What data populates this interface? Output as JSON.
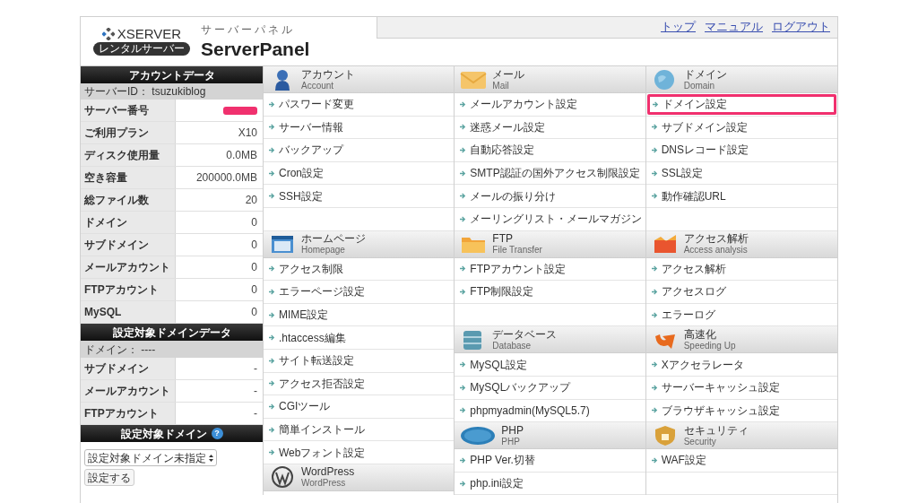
{
  "header": {
    "brand": "XSERVER",
    "brand_badge": "レンタルサーバー",
    "product_kana": "サーバーパネル",
    "product": "ServerPanel",
    "links": [
      "トップ",
      "マニュアル",
      "ログアウト"
    ]
  },
  "sidebar": {
    "account_title": "アカウントデータ",
    "server_id": "サーバーID： tsuzukiblog",
    "account_rows": [
      {
        "label": "サーバー番号",
        "redacted": true
      },
      {
        "label": "ご利用プラン",
        "value": "X10",
        "redacted": false
      },
      {
        "label": "ディスク使用量",
        "value": "0.0MB",
        "redacted": false
      },
      {
        "label": "空き容量",
        "value": "200000.0MB",
        "redacted": false
      },
      {
        "label": "総ファイル数",
        "value": "20",
        "redacted": false
      },
      {
        "label": "ドメイン",
        "value": "0",
        "redacted": false
      },
      {
        "label": "サブドメイン",
        "value": "0",
        "redacted": false
      },
      {
        "label": "メールアカウント",
        "value": "0",
        "redacted": false
      },
      {
        "label": "FTPアカウント",
        "value": "0",
        "redacted": false
      },
      {
        "label": "MySQL",
        "value": "0",
        "redacted": false
      }
    ],
    "domain_title": "設定対象ドメインデータ",
    "domain_line": "ドメイン： ----",
    "domain_rows": [
      {
        "label": "サブドメイン",
        "value": "-"
      },
      {
        "label": "メールアカウント",
        "value": "-"
      },
      {
        "label": "FTPアカウント",
        "value": "-"
      }
    ],
    "target_title": "設定対象ドメイン",
    "help": "?",
    "select_value": "設定対象ドメイン未指定",
    "set_button": "設定する"
  },
  "columns": [
    {
      "sections": [
        {
          "kind": "account",
          "title": "アカウント",
          "subtitle": "Account",
          "items": [
            {
              "label": "パスワード変更",
              "highlighted": false
            },
            {
              "label": "サーバー情報",
              "highlighted": false
            },
            {
              "label": "バックアップ",
              "highlighted": false
            },
            {
              "label": "Cron設定",
              "highlighted": false
            },
            {
              "label": "SSH設定",
              "highlighted": false
            }
          ]
        },
        {
          "kind": "homepage",
          "title": "ホームページ",
          "subtitle": "Homepage",
          "items": [
            {
              "label": "アクセス制限",
              "highlighted": false
            },
            {
              "label": "エラーページ設定",
              "highlighted": false
            },
            {
              "label": "MIME設定",
              "highlighted": false
            },
            {
              "label": ".htaccess編集",
              "highlighted": false
            },
            {
              "label": "サイト転送設定",
              "highlighted": false
            },
            {
              "label": "アクセス拒否設定",
              "highlighted": false
            },
            {
              "label": "CGIツール",
              "highlighted": false
            },
            {
              "label": "簡単インストール",
              "highlighted": false
            },
            {
              "label": "Webフォント設定",
              "highlighted": false
            }
          ]
        },
        {
          "kind": "wordpress",
          "title": "WordPress",
          "subtitle": "WordPress"
        }
      ]
    },
    {
      "sections": [
        {
          "kind": "mail",
          "title": "メール",
          "subtitle": "Mail",
          "items": [
            {
              "label": "メールアカウント設定",
              "highlighted": false
            },
            {
              "label": "迷惑メール設定",
              "highlighted": false
            },
            {
              "label": "自動応答設定",
              "highlighted": false
            },
            {
              "label": "SMTP認証の国外アクセス制限設定",
              "highlighted": false
            },
            {
              "label": "メールの振り分け",
              "highlighted": false
            },
            {
              "label": "メーリングリスト・メールマガジン",
              "highlighted": false
            }
          ]
        },
        {
          "kind": "ftp",
          "title": "FTP",
          "subtitle": "File Transfer",
          "items": [
            {
              "label": "FTPアカウント設定",
              "highlighted": false
            },
            {
              "label": "FTP制限設定",
              "highlighted": false
            }
          ]
        },
        {
          "kind": "database",
          "title": "データベース",
          "subtitle": "Database",
          "items": [
            {
              "label": "MySQL設定",
              "highlighted": false
            },
            {
              "label": "MySQLバックアップ",
              "highlighted": false
            },
            {
              "label": "phpmyadmin(MySQL5.7)",
              "highlighted": false
            }
          ]
        },
        {
          "kind": "php",
          "title": "PHP",
          "subtitle": "PHP",
          "items": [
            {
              "label": "PHP Ver.切替",
              "highlighted": false
            },
            {
              "label": "php.ini設定",
              "highlighted": false
            }
          ]
        }
      ]
    },
    {
      "sections": [
        {
          "kind": "domain",
          "title": "ドメイン",
          "subtitle": "Domain",
          "items": [
            {
              "label": "ドメイン設定",
              "highlighted": true
            },
            {
              "label": "サブドメイン設定",
              "highlighted": false
            },
            {
              "label": "DNSレコード設定",
              "highlighted": false
            },
            {
              "label": "SSL設定",
              "highlighted": false
            },
            {
              "label": "動作確認URL",
              "highlighted": false
            }
          ]
        },
        {
          "kind": "analytics",
          "title": "アクセス解析",
          "subtitle": "Access analysis",
          "items": [
            {
              "label": "アクセス解析",
              "highlighted": false
            },
            {
              "label": "アクセスログ",
              "highlighted": false
            },
            {
              "label": "エラーログ",
              "highlighted": false
            }
          ]
        },
        {
          "kind": "speed",
          "title": "高速化",
          "subtitle": "Speeding Up",
          "items": [
            {
              "label": "Xアクセラレータ",
              "highlighted": false
            },
            {
              "label": "サーバーキャッシュ設定",
              "highlighted": false
            },
            {
              "label": "ブラウザキャッシュ設定",
              "highlighted": false
            }
          ]
        },
        {
          "kind": "security",
          "title": "セキュリティ",
          "subtitle": "Security",
          "items": [
            {
              "label": "WAF設定",
              "highlighted": false
            }
          ]
        }
      ]
    }
  ]
}
